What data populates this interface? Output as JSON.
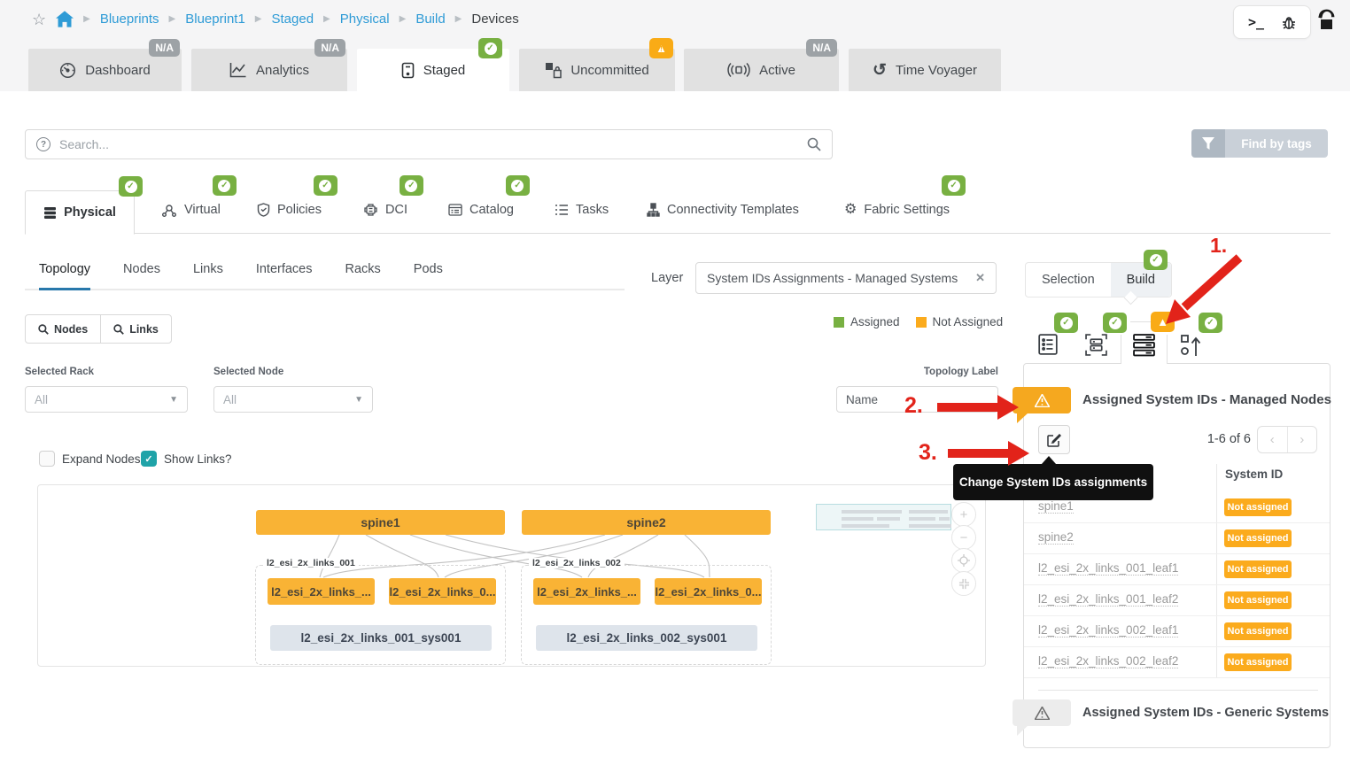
{
  "breadcrumb": {
    "items": [
      "Blueprints",
      "Blueprint1",
      "Staged",
      "Physical",
      "Build",
      "Devices"
    ]
  },
  "utility": {
    "terminal_glyph": ">_"
  },
  "main_tabs": [
    {
      "label": "Dashboard",
      "badge": "N/A"
    },
    {
      "label": "Analytics",
      "badge": "N/A"
    },
    {
      "label": "Staged",
      "badge": "check"
    },
    {
      "label": "Uncommitted",
      "badge": "warning"
    },
    {
      "label": "Active",
      "badge": "N/A"
    },
    {
      "label": "Time Voyager",
      "badge": ""
    }
  ],
  "search": {
    "placeholder": "Search...",
    "find_by_tags_label": "Find by tags"
  },
  "section_tabs": [
    {
      "label": "Physical"
    },
    {
      "label": "Virtual"
    },
    {
      "label": "Policies"
    },
    {
      "label": "DCI"
    },
    {
      "label": "Catalog"
    },
    {
      "label": "Tasks"
    },
    {
      "label": "Connectivity Templates"
    },
    {
      "label": "Fabric Settings"
    }
  ],
  "view_tabs": {
    "items": [
      "Topology",
      "Nodes",
      "Links",
      "Interfaces",
      "Racks",
      "Pods"
    ],
    "active": "Topology"
  },
  "layer": {
    "label": "Layer",
    "value": "System IDs Assignments - Managed Systems"
  },
  "legend": {
    "assigned": "Assigned",
    "not_assigned": "Not Assigned"
  },
  "quick_buttons": {
    "nodes": "Nodes",
    "links": "Links"
  },
  "filters": {
    "selected_rack_label": "Selected Rack",
    "selected_rack_value": "All",
    "selected_node_label": "Selected Node",
    "selected_node_value": "All",
    "topology_label_label": "Topology Label",
    "topology_label_value": "Name"
  },
  "toggles": {
    "expand_nodes": "Expand Nodes?",
    "show_links": "Show Links?"
  },
  "topology": {
    "spines": [
      "spine1",
      "spine2"
    ],
    "groups": [
      {
        "label": "l2_esi_2x_links_001",
        "leaves": [
          "l2_esi_2x_links_...",
          "l2_esi_2x_links_0..."
        ],
        "system": "l2_esi_2x_links_001_sys001"
      },
      {
        "label": "l2_esi_2x_links_002",
        "leaves": [
          "l2_esi_2x_links_...",
          "l2_esi_2x_links_0..."
        ],
        "system": "l2_esi_2x_links_002_sys001"
      }
    ]
  },
  "build_panel": {
    "tabs": [
      "Selection",
      "Build"
    ],
    "active_tab": "Build",
    "managed_heading": "Assigned System IDs - Managed Nodes",
    "generic_heading": "Assigned System IDs - Generic Systems",
    "pagination": "1-6 of 6",
    "column_header": "System ID",
    "tooltip": "Change System IDs assignments",
    "rows": [
      {
        "name": "spine1",
        "status": "Not assigned"
      },
      {
        "name": "spine2",
        "status": "Not assigned"
      },
      {
        "name": "l2_esi_2x_links_001_leaf1",
        "status": "Not assigned"
      },
      {
        "name": "l2_esi_2x_links_001_leaf2",
        "status": "Not assigned"
      },
      {
        "name": "l2_esi_2x_links_002_leaf1",
        "status": "Not assigned"
      },
      {
        "name": "l2_esi_2x_links_002_leaf2",
        "status": "Not assigned"
      }
    ]
  },
  "annotations": {
    "step1": "1.",
    "step2": "2.",
    "step3": "3."
  },
  "colors": {
    "accent_blue": "#2e9bd6",
    "orange": "#f9ab16",
    "green": "#78b042",
    "red": "#e2231a",
    "teal": "#1fa3a8"
  }
}
